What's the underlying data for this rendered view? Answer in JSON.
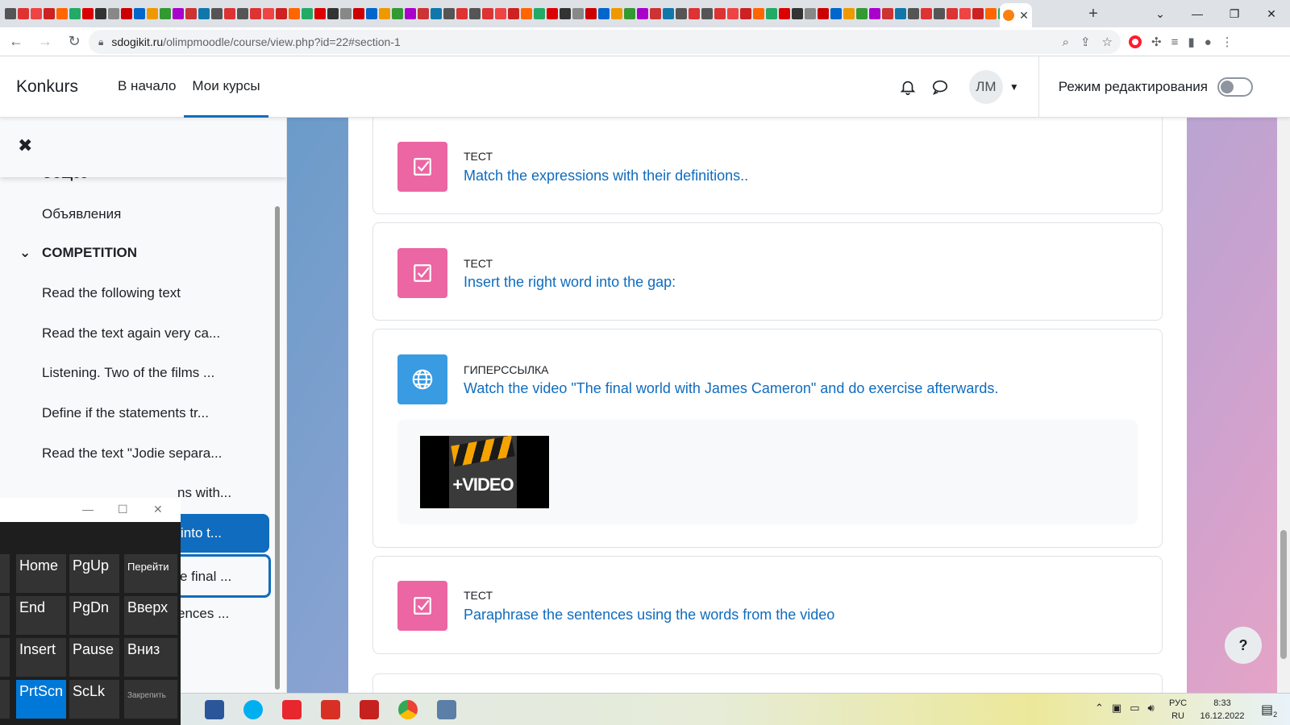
{
  "browser": {
    "tab_close": "✕",
    "new_tab": "+",
    "url_host": "sdogikit.ru",
    "url_path": "/olimpmoodle/course/view.php?id=22#section-1",
    "window_controls": [
      "⌄",
      "—",
      "❐",
      "✕"
    ]
  },
  "navbar": {
    "brand": "Konkurs",
    "links": [
      {
        "label": "В начало",
        "active": false
      },
      {
        "label": "Мои курсы",
        "active": true
      }
    ],
    "avatar_initials": "ЛМ",
    "edit_mode_label": "Режим редактирования"
  },
  "course_index": {
    "section_general": "Общее",
    "general_items": [
      "Объявления"
    ],
    "section_competition": "COMPETITION",
    "items": [
      "Read the following text",
      "Read the text again very ca...",
      "Listening. Two of the films ...",
      "Define if the statements tr...",
      "Read the text \"Jodie separa...",
      "ns with...",
      "into t...",
      "e final ...",
      "ences ..."
    ]
  },
  "activities": [
    {
      "type": "Тест",
      "name": "Match the expressions with their definitions..",
      "icon": "quiz"
    },
    {
      "type": "Тест",
      "name": "Insert the right word into the gap:",
      "icon": "quiz"
    },
    {
      "type": "Гиперссылка",
      "name": "Watch the video \"The final world with James Cameron\" and do exercise afterwards.",
      "icon": "url",
      "media_text": "+VIDEO"
    },
    {
      "type": "Тест",
      "name": "Paraphrase the sentences using the words from the video",
      "icon": "quiz"
    }
  ],
  "help_label": "?",
  "osk": {
    "keys": [
      "Home",
      "PgUp",
      "Перейти",
      "End",
      "PgDn",
      "Вверх",
      "Insert",
      "Pause",
      "Вниз",
      "PrtScn",
      "ScLk",
      "Закрепить"
    ]
  },
  "taskbar": {
    "lang_top": "РУС",
    "lang_bottom": "RU",
    "time": "8:33",
    "date": "16.12.2022",
    "notifications": "2"
  },
  "colors": {
    "brand_blue": "#0f6cbf",
    "quiz_pink": "#eb66a2",
    "url_blue": "#399be2"
  }
}
